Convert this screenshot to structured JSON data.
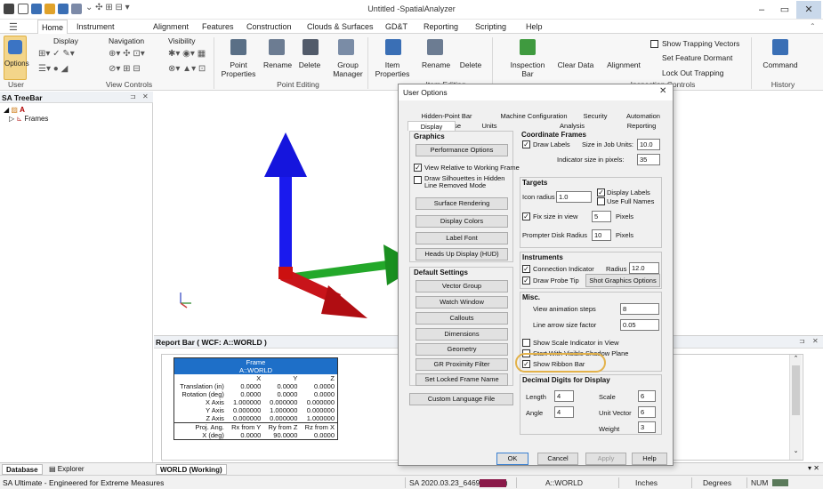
{
  "window": {
    "title": "Untitled -SpatialAnalyzer"
  },
  "tabs": [
    "Home",
    "Instrument",
    "Alignment",
    "Features",
    "Construction",
    "Clouds & Surfaces",
    "GD&T",
    "Reporting",
    "Scripting",
    "Help"
  ],
  "ribbon": {
    "options": "Options",
    "display": "Display",
    "navigation": "Navigation",
    "visibility": "Visibility",
    "point_properties": "Point\nProperties",
    "rename": "Rename",
    "delete": "Delete",
    "group_manager": "Group\nManager",
    "item_properties": "Item\nProperties",
    "item_rename": "Rename",
    "item_delete": "Delete",
    "inspection_bar": "Inspection\nBar",
    "clear_data": "Clear Data",
    "alignment": "Alignment",
    "show_trapping": "Show Trapping Vectors",
    "set_dormant": "Set Feature Dormant",
    "lock_trapping": "Lock Out Trapping",
    "command": "Command",
    "groups": {
      "user": "User",
      "view_controls": "View Controls",
      "point_editing": "Point Editing",
      "item_editing": "Item Editing",
      "inspection_controls": "Inspection Controls",
      "history": "History"
    }
  },
  "treebar": {
    "title": "SA TreeBar",
    "root": "A",
    "frames": "Frames"
  },
  "report": {
    "title": "Report Bar ( WCF: A::WORLD )",
    "frame_header": "Frame",
    "frame_name": "A::WORLD",
    "cols": [
      "X",
      "Y",
      "Z"
    ],
    "rows": [
      [
        "Translation (in)",
        "0.0000",
        "0.0000",
        "0.0000"
      ],
      [
        "Rotation (deg)",
        "0.0000",
        "0.0000",
        "0.0000"
      ],
      [
        "X Axis",
        "1.000000",
        "0.000000",
        "0.000000"
      ],
      [
        "Y Axis",
        "0.000000",
        "1.000000",
        "0.000000"
      ],
      [
        "Z Axis",
        "0.000000",
        "0.000000",
        "1.000000"
      ],
      [
        "Proj. Ang.",
        "Rx from Y",
        "Ry from Z",
        "Rz from X"
      ],
      [
        "X (deg)",
        "0.0000",
        "90.0000",
        "0.0000"
      ]
    ]
  },
  "bottom_tabs": {
    "database": "Database",
    "explorer": "Explorer",
    "working": "WORLD (Working)"
  },
  "status": {
    "app": "SA Ultimate - Engineered for Extreme Measures",
    "version": "SA 2020.03.23_64697 ( x64 )",
    "frame": "A::WORLD",
    "units": "Inches",
    "angle": "Degrees",
    "num": "NUM"
  },
  "dialog": {
    "title": "User Options",
    "tabs_top": [
      "Hidden-Point Bar Database",
      "Machine Configuration",
      "Security",
      "Automation"
    ],
    "tabs_bottom": [
      "Display",
      "Units",
      "Analysis",
      "Reporting"
    ],
    "graphics": {
      "title": "Graphics",
      "perf": "Performance Options",
      "view_relative": "View Relative to Working Frame",
      "draw_silhouettes": "Draw Silhouettes in Hidden Line Removed Mode",
      "surface": "Surface Rendering",
      "colors": "Display Colors",
      "label_font": "Label Font",
      "hud": "Heads Up Display (HUD)"
    },
    "defaults": {
      "title": "Default Settings",
      "vector_group": "Vector Group",
      "watch": "Watch Window",
      "callouts": "Callouts",
      "dimensions": "Dimensions",
      "geometry": "Geometry",
      "gr": "GR Proximity Filter",
      "locked": "Set Locked Frame Name"
    },
    "custom_lang": "Custom Language File",
    "coord": {
      "title": "Coordinate Frames",
      "draw_labels": "Draw Labels",
      "size_units": "Size in Job Units:",
      "size_val": "10.0",
      "indicator": "Indicator size in pixels:",
      "indicator_val": "35"
    },
    "targets": {
      "title": "Targets",
      "icon_radius": "Icon radius",
      "icon_val": "1.0",
      "display_labels": "Display Labels",
      "full_names": "Use Full Names",
      "fix_size": "Fix size in view",
      "fix_val": "5",
      "pixels": "Pixels",
      "prompter": "Prompter Disk Radius",
      "prompter_val": "10",
      "pixels2": "Pixels"
    },
    "instruments": {
      "title": "Instruments",
      "connection": "Connection Indicator",
      "radius": "Radius",
      "radius_val": "12.0",
      "probe": "Draw Probe Tip",
      "shot": "Shot Graphics Options"
    },
    "misc": {
      "title": "Misc.",
      "anim": "View animation steps",
      "anim_val": "8",
      "arrow": "Line arrow size factor",
      "arrow_val": "0.05",
      "scale": "Show Scale Indicator in View",
      "shadow": "Start With Visible Shadow Plane",
      "ribbon": "Show Ribbon Bar"
    },
    "decimal": {
      "title": "Decimal Digits for Display",
      "length": "Length",
      "length_val": "4",
      "angle": "Angle",
      "angle_val": "4",
      "scale": "Scale",
      "scale_val": "6",
      "unit": "Unit Vector",
      "unit_val": "6",
      "weight": "Weight",
      "weight_val": "3"
    },
    "buttons": {
      "ok": "OK",
      "cancel": "Cancel",
      "apply": "Apply",
      "help": "Help"
    }
  }
}
